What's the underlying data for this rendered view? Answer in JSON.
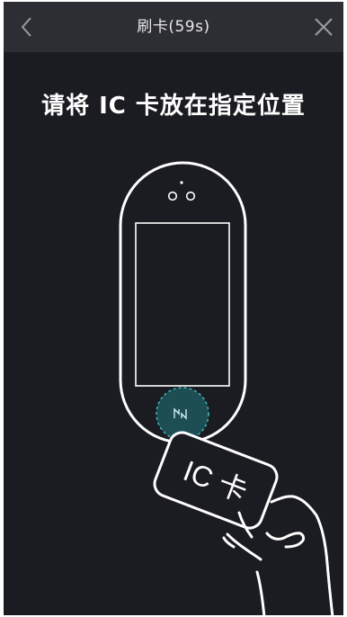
{
  "header": {
    "title": "刷卡(59s)",
    "back_icon": "chevron-left-icon",
    "close_icon": "close-icon"
  },
  "main": {
    "instruction": "请将 IC 卡放在指定位置"
  },
  "illustration": {
    "card_label": "IC 卡",
    "icons": [
      "face-terminal-icon",
      "nfc-reader-icon",
      "hand-icon",
      "ic-card-icon"
    ]
  },
  "colors": {
    "background": "#1b1c21",
    "header": "#2d2e33",
    "line": "#ffffff",
    "nfc_accent": "#1e8c91"
  }
}
